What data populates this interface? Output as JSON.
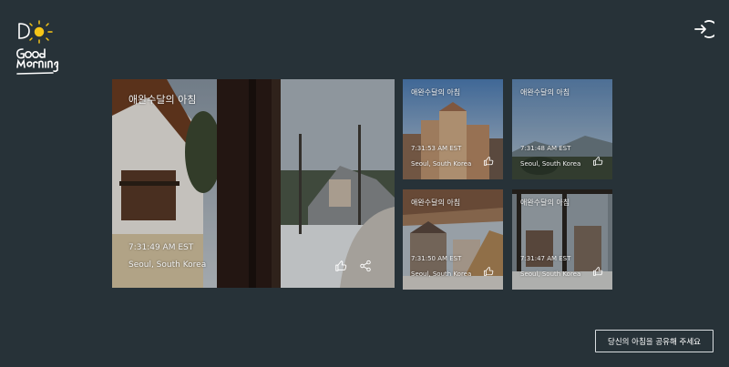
{
  "app": {
    "logo_text": [
      "Do",
      "Good",
      "Morning"
    ]
  },
  "header": {
    "logout_icon": "logout-icon"
  },
  "cards": [
    {
      "title": "애완수달의 아침",
      "time": "7:31:49 AM EST",
      "location": "Seoul, South Korea"
    },
    {
      "title": "애완수달의 아침",
      "time": "7:31:53 AM EST",
      "location": "Seoul, South Korea"
    },
    {
      "title": "애완수달의 아침",
      "time": "7:31:48 AM EST",
      "location": "Seoul, South Korea"
    },
    {
      "title": "애완수달의 아침",
      "time": "7:31:50 AM EST",
      "location": "Seoul, South Korea"
    },
    {
      "title": "애완수달의 아침",
      "time": "7:31:47 AM EST",
      "location": "Seoul, South Korea"
    }
  ],
  "footer": {
    "share_label": "당신의 아침을 공유해 주세요"
  },
  "colors": {
    "background": "#273238",
    "accent": "#f5c518"
  }
}
